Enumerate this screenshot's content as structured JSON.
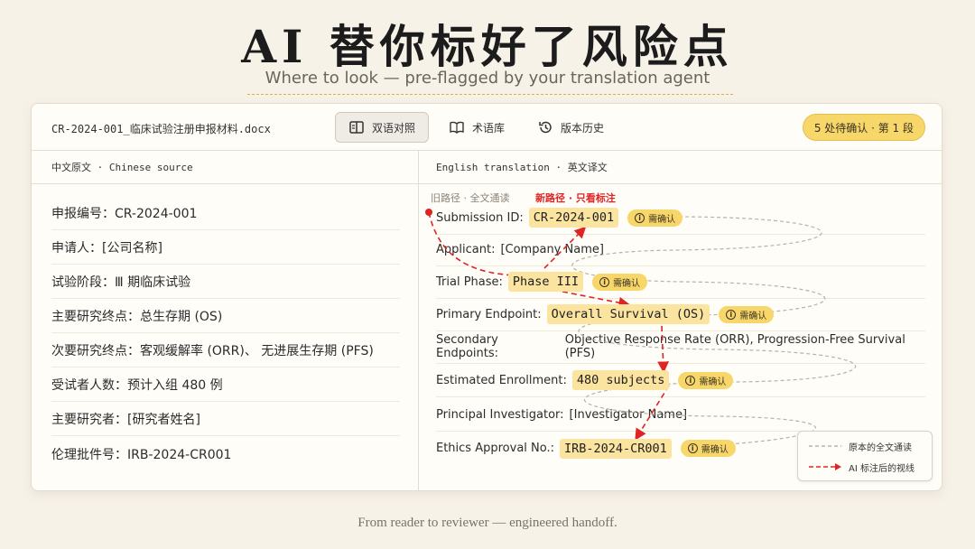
{
  "hero": {
    "title": "AI 替你标好了风险点",
    "subtitle": "Where to look — pre-flagged by your translation agent"
  },
  "toolbar": {
    "filename": "CR-2024-001_临床试验注册申报材料.docx",
    "bilingual_label": "双语对照",
    "glossary_label": "术语库",
    "history_label": "版本历史",
    "pending_badge": "5 处待确认 · 第 1 段"
  },
  "columns": {
    "source_header": "中文原文 · Chinese source",
    "translation_header": "English translation · 英文译文"
  },
  "source_rows": [
    "申报编号：CR-2024-001",
    "申请人：[公司名称]",
    "试验阶段：Ⅲ 期临床试验",
    "主要研究终点：总生存期 (OS)",
    "次要研究终点：客观缓解率 (ORR)、 无进展生存期 (PFS)",
    "受试者人数：预计入组 480 例",
    "主要研究者：[研究者姓名]",
    "伦理批件号：IRB-2024-CR001"
  ],
  "path_legend": {
    "old": "旧路径 · 全文通读",
    "new": "新路径 · 只看标注"
  },
  "translation_rows": [
    {
      "label": "Submission ID:",
      "value": "CR-2024-001",
      "flagged": true
    },
    {
      "label": "Applicant:",
      "value": "[Company Name]",
      "flagged": false
    },
    {
      "label": "Trial Phase:",
      "value": "Phase III",
      "flagged": true
    },
    {
      "label": "Primary Endpoint:",
      "value": "Overall Survival (OS)",
      "flagged": true
    },
    {
      "label": "Secondary Endpoints:",
      "value": "Objective Response Rate (ORR), Progression-Free Survival (PFS)",
      "flagged": false
    },
    {
      "label": "Estimated Enrollment:",
      "value": "480 subjects",
      "flagged": true
    },
    {
      "label": "Principal Investigator:",
      "value": "[Investigator Name]",
      "flagged": false
    },
    {
      "label": "Ethics Approval No.:",
      "value": "IRB-2024-CR001",
      "flagged": true
    }
  ],
  "confirm_tag": "需确认",
  "legend": {
    "old_path": "原本的全文通读",
    "new_path": "AI 标注后的视线"
  },
  "footer": "From reader to reviewer — engineered handoff.",
  "colors": {
    "highlight": "#fbe3a0",
    "badge": "#f7d66a",
    "new_path": "#e02424",
    "old_path": "#b8b2a8"
  }
}
